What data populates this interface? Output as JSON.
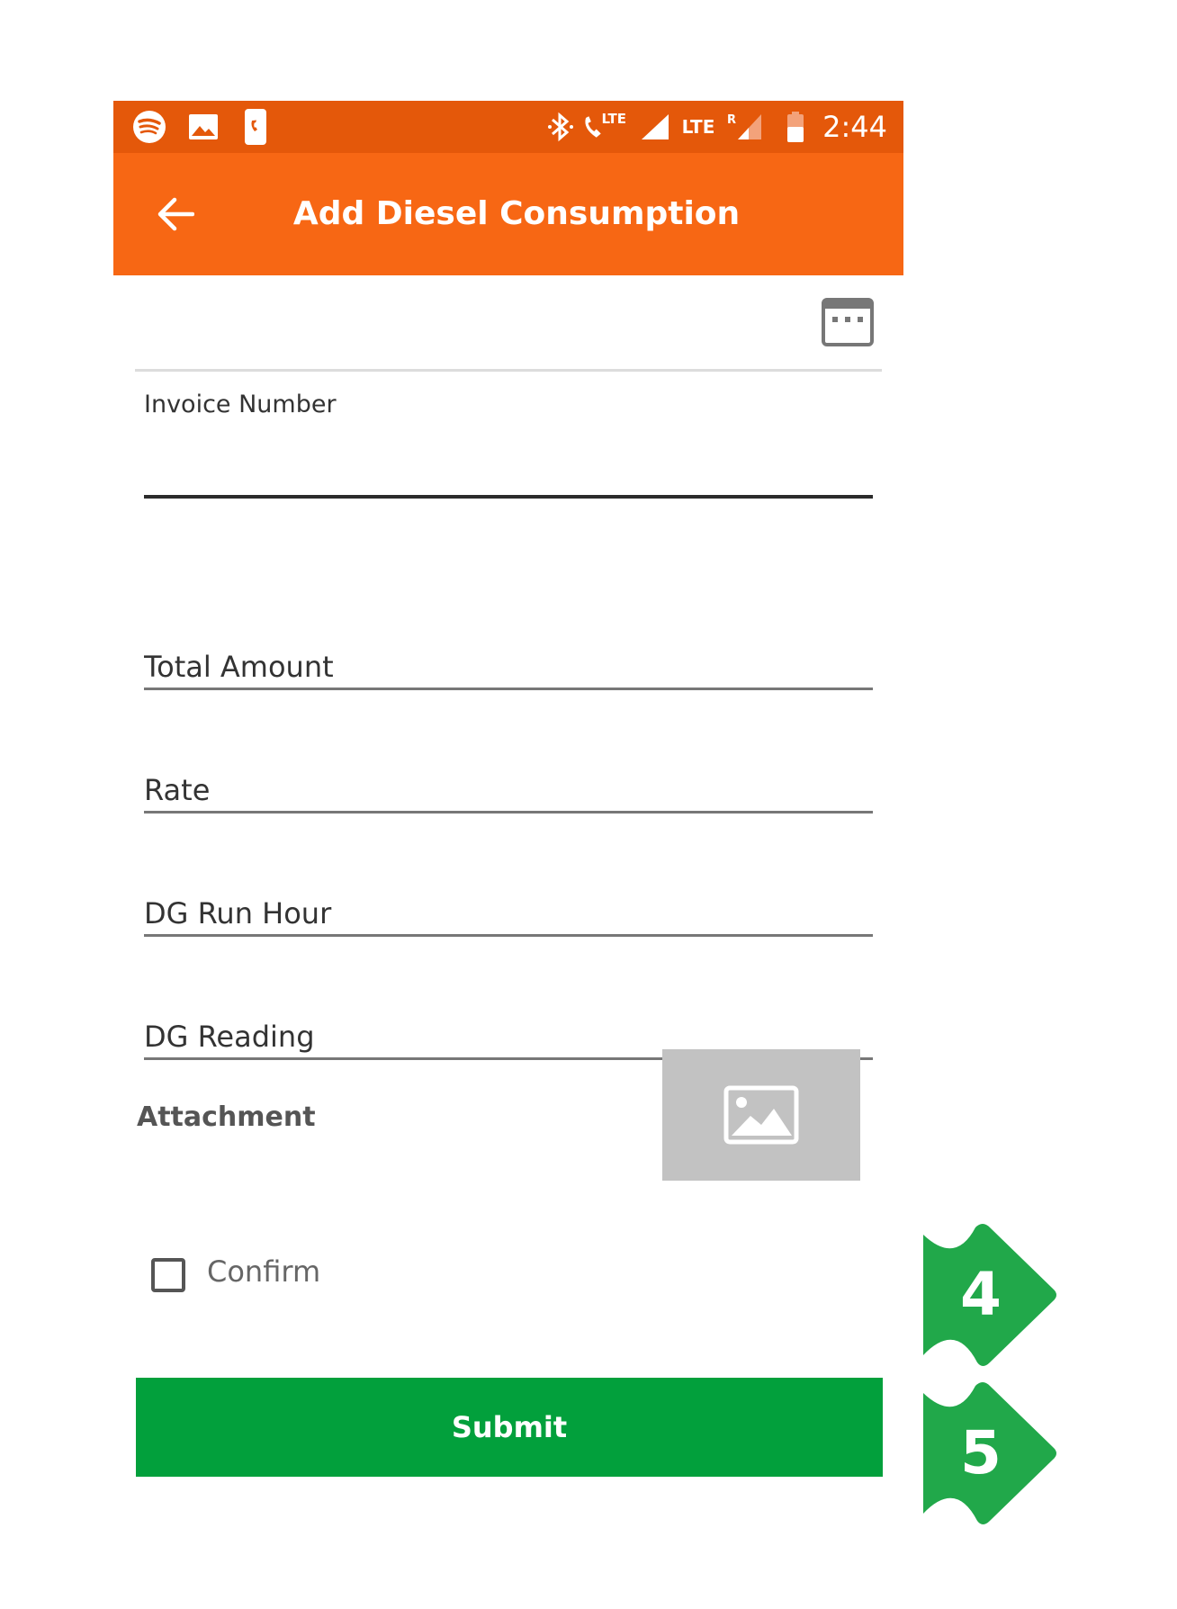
{
  "status_bar": {
    "time": "2:44",
    "left_icons": [
      "spotify-icon",
      "image-icon",
      "phone-call-icon"
    ],
    "right_icons": [
      "bluetooth-icon",
      "volte-call-icon",
      "signal-icon",
      "lte-signal-icon",
      "battery-icon"
    ],
    "lte_label_1": "LTE",
    "lte_label_2": "LTE",
    "roaming_label": "R"
  },
  "app_bar": {
    "title": "Add Diesel Consumption",
    "back_icon": "arrow-left-icon"
  },
  "form": {
    "date_icon": "calendar-icon",
    "invoice_label": "Invoice Number",
    "total_amount_placeholder": "Total Amount",
    "rate_placeholder": "Rate",
    "dg_run_hour_placeholder": "DG Run Hour",
    "dg_reading_placeholder": "DG Reading",
    "attachment_label": "Attachment",
    "attachment_icon": "image-placeholder-icon",
    "confirm_label": "Confirm",
    "confirm_checked": false,
    "submit_label": "Submit"
  },
  "annotations": {
    "step_4": "4",
    "step_5": "5",
    "badge_color": "#21a84a"
  },
  "colors": {
    "status_bar": "#e4580a",
    "app_bar": "#f76714",
    "submit": "#02a03c"
  }
}
